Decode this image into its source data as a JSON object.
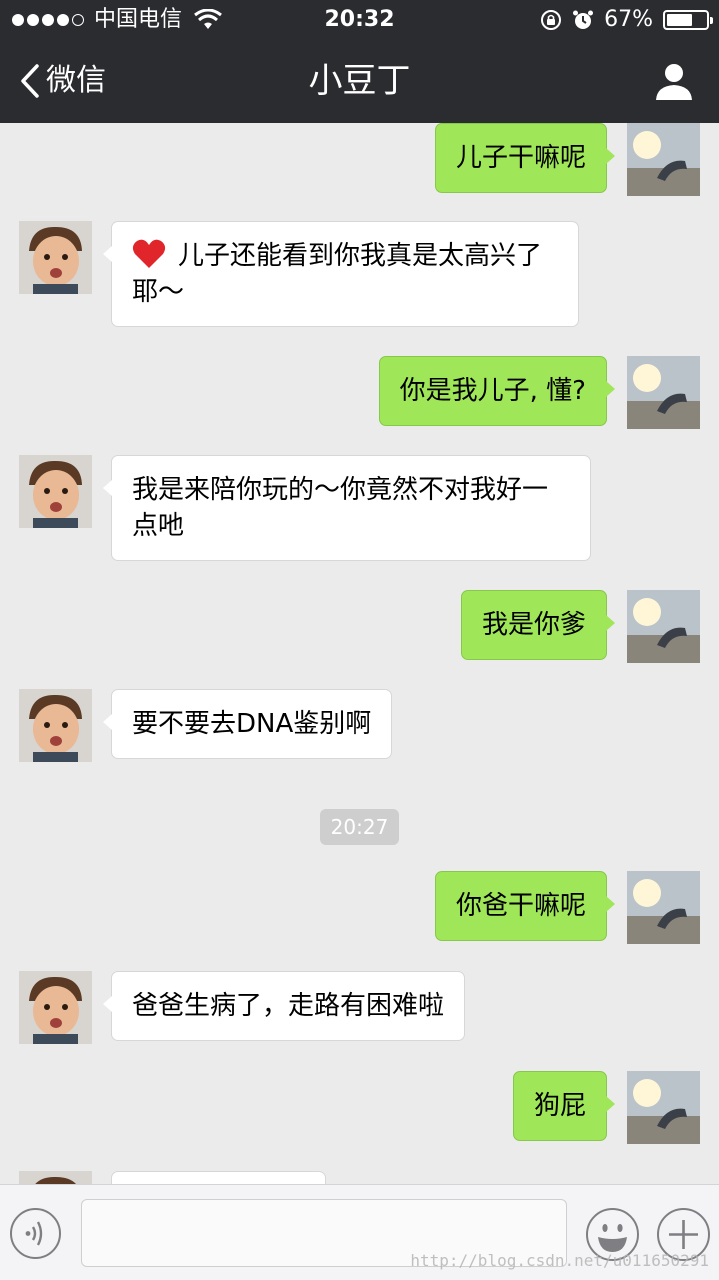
{
  "status_bar": {
    "carrier": "中国电信",
    "time": "20:32",
    "battery_percent": "67%",
    "battery_level": 0.67,
    "signal_bars_filled": 4,
    "signal_bars_total": 5
  },
  "nav": {
    "back_label": "微信",
    "title": "小豆丁",
    "back_icon": "chevron-left-icon",
    "profile_icon": "person-icon"
  },
  "messages": [
    {
      "from": "self",
      "text": "儿子干嘛呢"
    },
    {
      "from": "friend",
      "text": "儿子还能看到你我真是太高兴了耶～",
      "leading_emoji": "heart"
    },
    {
      "from": "self",
      "text": "你是我儿子, 懂?"
    },
    {
      "from": "friend",
      "text": "我是来陪你玩的～你竟然不对我好一点吔"
    },
    {
      "from": "self",
      "text": "我是你爹"
    },
    {
      "from": "friend",
      "text": "要不要去DNA鉴别啊"
    },
    {
      "from": "self",
      "text": "你爸干嘛呢"
    },
    {
      "from": "friend",
      "text": "爸爸生病了，走路有困难啦"
    },
    {
      "from": "self",
      "text": "狗屁"
    }
  ],
  "time_separator": "20:27",
  "input_bar": {
    "voice_icon": "voice-icon",
    "emoji_icon": "emoji-icon",
    "plus_icon": "plus-icon"
  },
  "watermark": "http://blog.csdn.net/u011650291",
  "colors": {
    "header_bg": "#2b2c30",
    "chat_bg": "#ebebeb",
    "outgoing_bubble": "#9fe658",
    "incoming_bubble": "#ffffff"
  }
}
